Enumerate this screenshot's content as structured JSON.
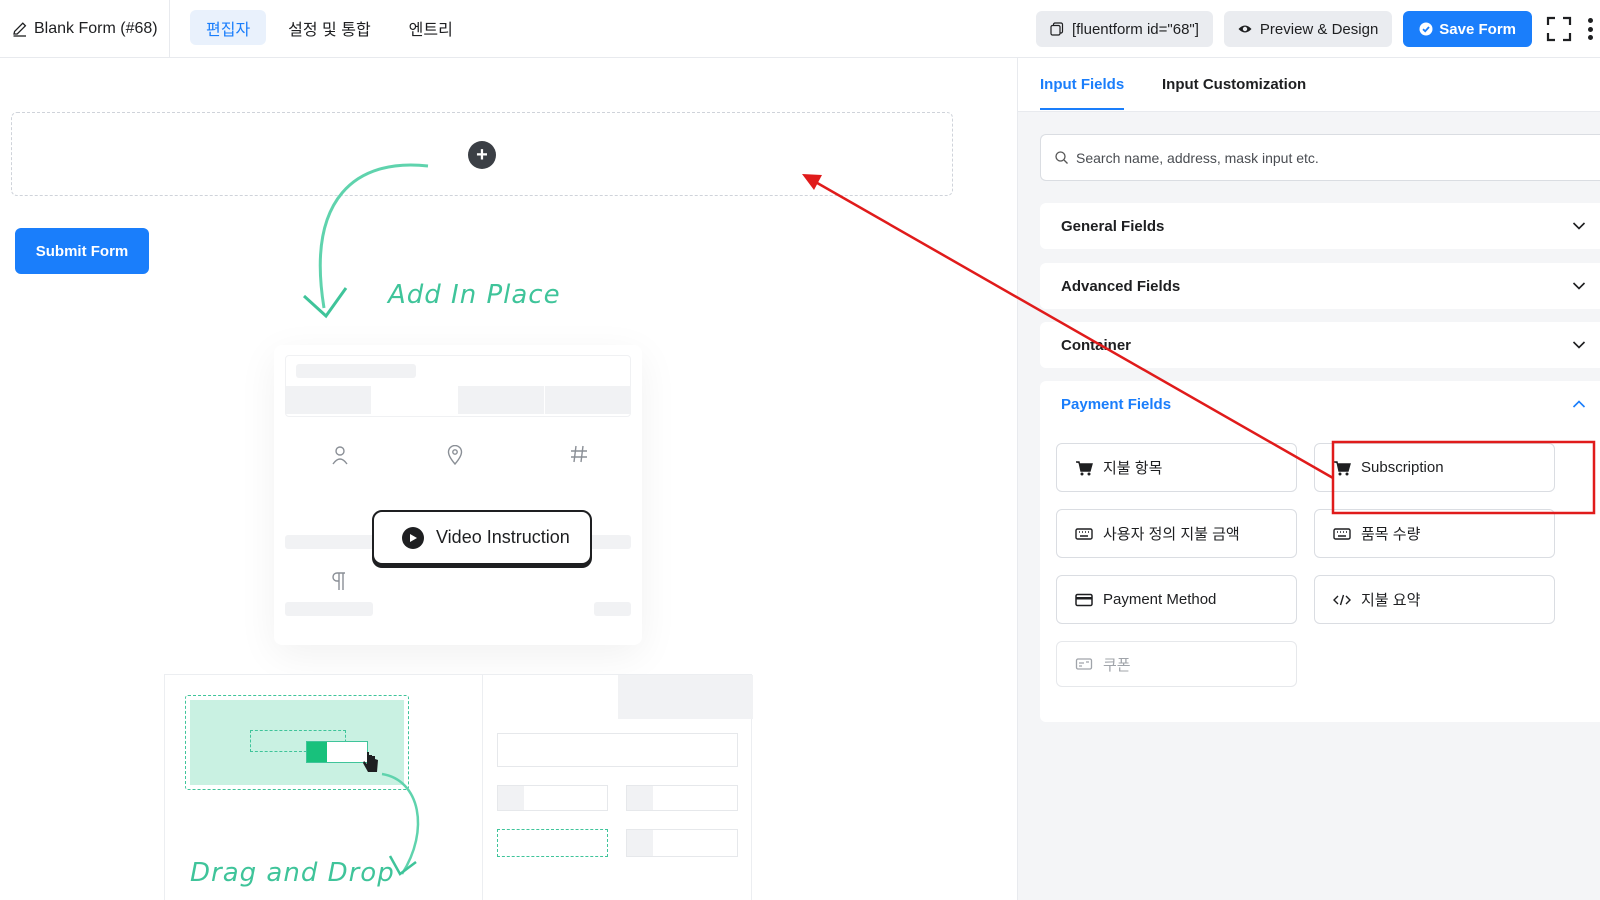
{
  "header": {
    "form_title": "Blank Form (#68)",
    "tabs": [
      {
        "label": "편집자",
        "active": true
      },
      {
        "label": "설정 및 통합",
        "active": false
      },
      {
        "label": "엔트리",
        "active": false
      }
    ],
    "shortcode_label": "[fluentform id=\"68\"]",
    "preview_label": "Preview & Design",
    "save_label": "Save Form"
  },
  "canvas": {
    "submit_label": "Submit Form",
    "add_in_place_label": "Add In Place",
    "video_label": "Video Instruction",
    "drag_drop_label": "Drag and Drop"
  },
  "sidebar": {
    "tabs": [
      {
        "label": "Input Fields",
        "active": true
      },
      {
        "label": "Input Customization",
        "active": false
      }
    ],
    "search_placeholder": "Search name, address, mask input etc.",
    "sections": [
      {
        "label": "General Fields",
        "open": false
      },
      {
        "label": "Advanced Fields",
        "open": false
      },
      {
        "label": "Container",
        "open": false
      },
      {
        "label": "Payment Fields",
        "open": true
      }
    ],
    "payment_items": [
      {
        "label": "지불 항목",
        "icon": "cart-icon"
      },
      {
        "label": "Subscription",
        "icon": "cart-icon"
      },
      {
        "label": "사용자 정의 지불 금액",
        "icon": "keyboard-icon"
      },
      {
        "label": "품목 수량",
        "icon": "keyboard-icon"
      },
      {
        "label": "Payment Method",
        "icon": "credit-card-icon"
      },
      {
        "label": "지불 요약",
        "icon": "code-icon"
      },
      {
        "label": "쿠폰",
        "icon": "coupon-icon",
        "disabled": true
      }
    ]
  },
  "colors": {
    "accent": "#1a7efb",
    "highlight": "#e01b1b",
    "illustration_green": "#3fc49a"
  }
}
